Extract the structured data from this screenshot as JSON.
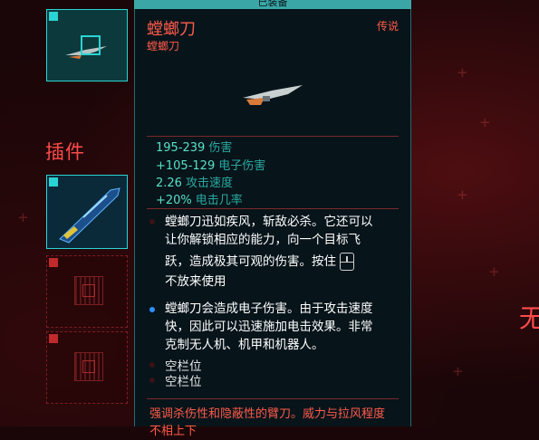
{
  "header": {
    "equipped_label": "已装备"
  },
  "item": {
    "name": "螳螂刀",
    "subname": "螳螂刀",
    "rarity": "传说",
    "stats": [
      {
        "value": "195-239",
        "label": "伤害"
      },
      {
        "value": "+105-129",
        "label": "电子伤害"
      },
      {
        "value": "2.26",
        "label": "攻击速度"
      },
      {
        "value": "+20%",
        "label": "电击几率"
      }
    ],
    "description_lines": [
      "螳螂刀迅如疾风，斩敌必杀。它还可以",
      "让你解锁相应的能力，向一个目标飞",
      "跃，造成极其可观的伤害。按住",
      "不放来使用"
    ],
    "effect_lines": [
      "螳螂刀会造成电子伤害。由于攻击速度",
      "快，因此可以迅速施加电击效果。非常",
      "克制无人机、机甲和机器人。"
    ],
    "empty_slots": [
      "空栏位",
      "空栏位"
    ],
    "flavor_lines": [
      "强调杀伤性和隐蔽性的臂刀。威力与拉风程度",
      "不相上下"
    ]
  },
  "sidebar": {
    "mods_label": "插件",
    "edge_text": "无"
  },
  "icons": {
    "mouse": "mouse-hold-icon",
    "slot_chip": "chip-icon"
  },
  "colors": {
    "accent_red": "#ff5b4b",
    "accent_cyan": "#2ad4d4",
    "stat_cyan": "#58e0c8",
    "bullet_blue": "#2f8fff"
  }
}
